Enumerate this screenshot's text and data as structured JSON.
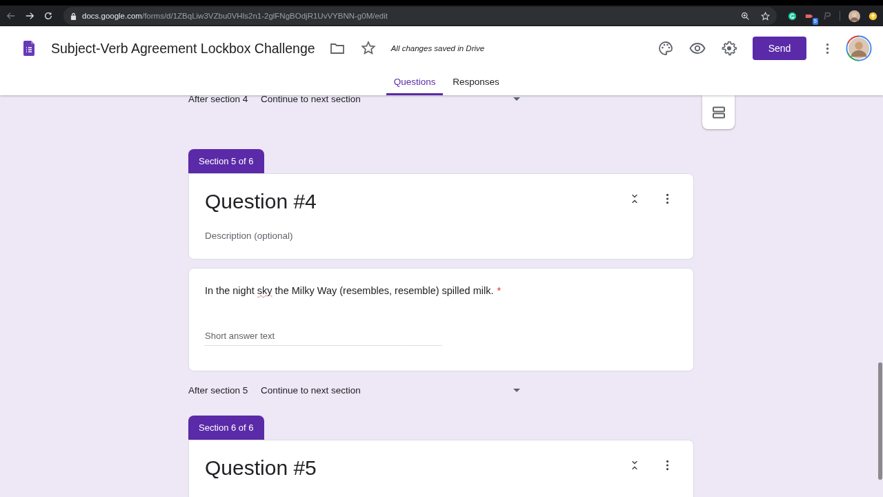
{
  "browser": {
    "url_host": "docs.google.com",
    "url_path": "/forms/d/1ZBqLiw3VZbu0VHls2n1-2glFNgBOdjR1UvVYBNN-g0M/edit",
    "extension_badge": "5"
  },
  "header": {
    "title": "Subject-Verb Agreement Lockbox Challenge",
    "save_status": "All changes saved in Drive",
    "send_label": "Send"
  },
  "tabs": [
    {
      "label": "Questions",
      "selected": true
    },
    {
      "label": "Responses",
      "selected": false
    }
  ],
  "sections": [
    {
      "kind": "after",
      "label": "After section 4",
      "value": "Continue to next section"
    },
    {
      "kind": "section",
      "badge": "Section 5 of 6",
      "title": "Question #4",
      "description_placeholder": "Description (optional)"
    },
    {
      "kind": "question",
      "parts": [
        {
          "text": "In the night ",
          "misspelled": false
        },
        {
          "text": "sky",
          "misspelled": true
        },
        {
          "text": " the Milky Way (resembles, resemble) spilled milk.",
          "misspelled": false
        }
      ],
      "required_mark": "*",
      "answer_placeholder": "Short answer text"
    },
    {
      "kind": "after",
      "label": "After section 5",
      "value": "Continue to next section"
    },
    {
      "kind": "section",
      "badge": "Section 6 of 6",
      "title": "Question #5"
    }
  ]
}
